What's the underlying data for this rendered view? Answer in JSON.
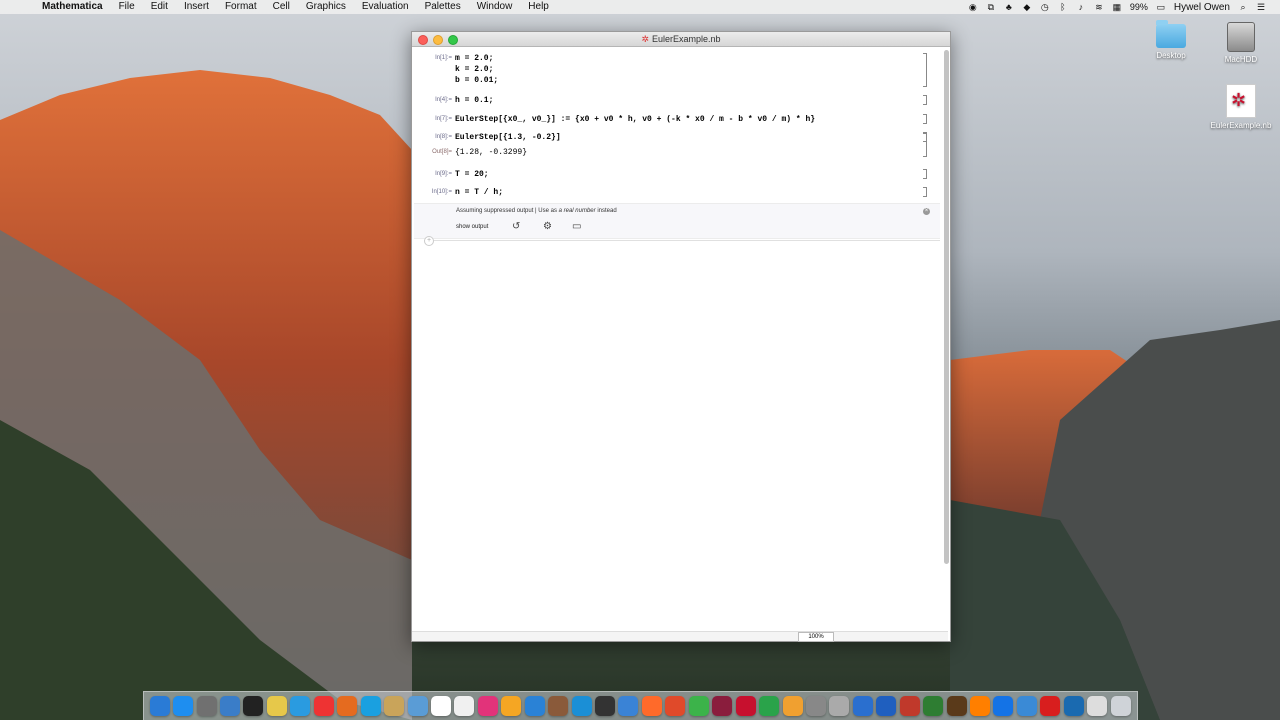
{
  "menubar": {
    "app_name": "Mathematica",
    "items": [
      "File",
      "Edit",
      "Insert",
      "Format",
      "Cell",
      "Graphics",
      "Evaluation",
      "Palettes",
      "Window",
      "Help"
    ],
    "battery": "99%",
    "user": "Hywel Owen"
  },
  "desktop": {
    "icons": [
      {
        "label": "Desktop",
        "icon": "folder-icon"
      },
      {
        "label": "MacHDD",
        "icon": "hard-drive-icon"
      },
      {
        "label": "EulerExample.nb",
        "icon": "notebook-file-icon"
      }
    ]
  },
  "window": {
    "title": "EulerExample.nb",
    "cells": [
      {
        "label": "In[1]:=",
        "code": "m = 2.0;\nk = 2.0;\nb = 0.01;"
      },
      {
        "label": "In[4]:=",
        "code": "h = 0.1;"
      },
      {
        "label": "In[7]:=",
        "code": "EulerStep[{x0_, v0_}] := {x0 + v0 * h, v0 + (-k * x0 / m - b * v0 / m) * h}"
      },
      {
        "label": "In[8]:=",
        "code": "EulerStep[{1.3, -0.2}]"
      },
      {
        "label": "Out[8]=",
        "code": "{1.28, -0.3299}"
      },
      {
        "label": "In[9]:=",
        "code": "T = 20;"
      },
      {
        "label": "In[10]:=",
        "code": "n = T / h;"
      }
    ],
    "suggestion": {
      "text_prefix": "Assuming suppressed output | Use as",
      "text_italic": "a real number",
      "text_suffix": "instead",
      "show_output": "show output"
    },
    "zoom": "100%"
  },
  "dock": {
    "apps": [
      "Finder",
      "App Store",
      "System Preferences",
      "Xcode",
      "Terminal",
      "Cyberduck",
      "Safari",
      "Chrome",
      "Firefox",
      "Skype",
      "Notes",
      "Preview",
      "Calendar",
      "Slack",
      "iTunes",
      "Photos",
      "Keynote",
      "Books",
      "Kindle",
      "GitHub",
      "Xcode Tools",
      "Sublime",
      "MATLAB",
      "Evernote",
      "Mathematica",
      "Mathematica Player",
      "Evernote Web",
      "Sketch",
      "TeXShop",
      "Drive",
      "WinZip",
      "Word",
      "PowerPoint",
      "Excel",
      "Scrivener",
      "Illustrator",
      "Photoshop",
      "Keynote Remote",
      "Acrobat",
      "Lightroom",
      "Documents",
      "Trash"
    ]
  }
}
